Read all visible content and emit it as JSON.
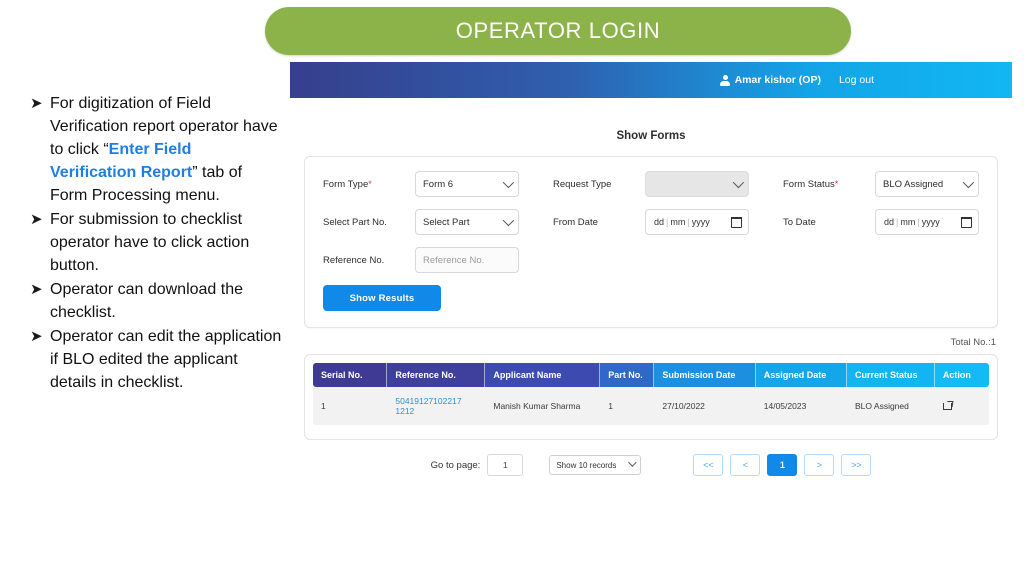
{
  "slide": {
    "title": "OPERATOR LOGIN",
    "title_color": "#8cb34a"
  },
  "notes": {
    "bullet_glyph": "➤",
    "items": [
      {
        "pre": "For digitization of Field Verification report operator have to click “",
        "highlight": "Enter Field Verification Report",
        "post": "” tab of Form Processing menu."
      },
      {
        "pre": "For submission to checklist operator have to click action button.",
        "highlight": "",
        "post": ""
      },
      {
        "pre": "Operator  can download the checklist.",
        "highlight": "",
        "post": ""
      },
      {
        "pre": "Operator can edit the application if BLO edited the applicant details in checklist.",
        "highlight": "",
        "post": ""
      }
    ]
  },
  "app": {
    "topbar": {
      "user_name": "Amar kishor (OP)",
      "logout_label": "Log out",
      "gradient_start": "#363f8c",
      "gradient_end": "#12b7f2"
    },
    "page_heading": "Show Forms",
    "form": {
      "form_type": {
        "label": "Form Type",
        "required": "*",
        "value": "Form 6"
      },
      "request_type": {
        "label": "Request Type",
        "value": "",
        "disabled": true
      },
      "form_status": {
        "label": "Form Status",
        "required": "*",
        "value": "BLO Assigned"
      },
      "select_part": {
        "label": "Select Part No.",
        "value": "Select Part"
      },
      "from_date": {
        "label": "From Date",
        "dd": "dd",
        "mm": "mm",
        "yyyy": "yyyy"
      },
      "to_date": {
        "label": "To Date",
        "dd": "dd",
        "mm": "mm",
        "yyyy": "yyyy"
      },
      "reference_no": {
        "label": "Reference No.",
        "placeholder": "Reference No.",
        "value": ""
      },
      "submit_button": "Show Results"
    },
    "total_label": "Total No.:1",
    "table": {
      "columns": [
        "Serial No.",
        "Reference No.",
        "Applicant Name",
        "Part No.",
        "Submission Date",
        "Assigned Date",
        "Current Status",
        "Action"
      ],
      "rows": [
        {
          "serial": "1",
          "reference": "50419127102217 1212",
          "applicant": "Manish Kumar Sharma",
          "part": "1",
          "submission_date": "27/10/2022",
          "assigned_date": "14/05/2023",
          "status": "BLO Assigned",
          "action_icon": "external-link-icon"
        }
      ]
    },
    "pagination": {
      "goto_label": "Go to page:",
      "goto_value": "1",
      "records_select": "Show 10 records",
      "first": "<<",
      "prev": "<",
      "current_page": "1",
      "next": ">",
      "last": ">>"
    }
  }
}
